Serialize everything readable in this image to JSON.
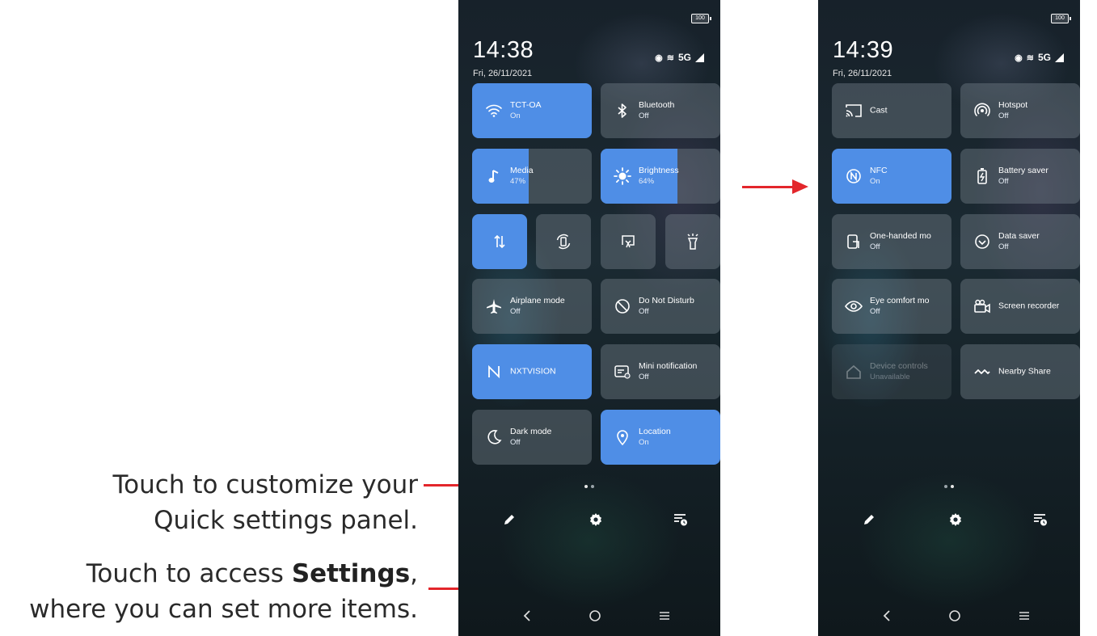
{
  "captions": {
    "customize_line1": "Touch to customize your",
    "customize_line2": "Quick settings panel.",
    "settings_pre": "Touch to access ",
    "settings_bold": "Settings",
    "settings_post": ",",
    "settings_line2": "where you can set more items."
  },
  "phone1": {
    "battery": "100",
    "time": "14:38",
    "date": "Fri, 26/11/2021",
    "network": "5G",
    "tiles": {
      "wifi": {
        "label": "TCT-OA",
        "status": "On"
      },
      "bluetooth": {
        "label": "Bluetooth",
        "status": "Off"
      },
      "media": {
        "label": "Media",
        "status": "47%",
        "level": 0.47
      },
      "brightness": {
        "label": "Brightness",
        "status": "64%",
        "level": 0.64
      },
      "airplane": {
        "label": "Airplane mode",
        "status": "Off"
      },
      "dnd": {
        "label": "Do Not Disturb",
        "status": "Off"
      },
      "nxtvision": {
        "label": "NXTVISION"
      },
      "mini_notification": {
        "label": "Mini notification",
        "status": "Off"
      },
      "dark_mode": {
        "label": "Dark mode",
        "status": "Off"
      },
      "location": {
        "label": "Location",
        "status": "On"
      }
    }
  },
  "phone2": {
    "battery": "100",
    "time": "14:39",
    "date": "Fri, 26/11/2021",
    "network": "5G",
    "tiles": {
      "cast": {
        "label": "Cast"
      },
      "hotspot": {
        "label": "Hotspot",
        "status": "Off"
      },
      "nfc": {
        "label": "NFC",
        "status": "On"
      },
      "battery_saver": {
        "label": "Battery saver",
        "status": "Off"
      },
      "one_handed": {
        "label": "One-handed mo",
        "status": "Off"
      },
      "data_saver": {
        "label": "Data saver",
        "status": "Off"
      },
      "eye_comfort": {
        "label": "Eye comfort mo",
        "status": "Off"
      },
      "screen_recorder": {
        "label": "Screen recorder"
      },
      "device_controls": {
        "label": "Device controls",
        "status": "Unavailable"
      },
      "nearby_share": {
        "label": "Nearby Share"
      }
    }
  },
  "icons": [
    "wifi-icon",
    "bluetooth-icon",
    "music-note-icon",
    "sun-icon",
    "data-arrows-icon",
    "auto-rotate-icon",
    "screenshot-icon",
    "flashlight-icon",
    "airplane-icon",
    "dnd-icon",
    "nxtvision-icon",
    "mini-notification-icon",
    "moon-icon",
    "location-pin-icon",
    "pencil-icon",
    "gear-icon",
    "notification-schedule-icon",
    "back-icon",
    "home-icon",
    "menu-icon",
    "cast-icon",
    "hotspot-icon",
    "nfc-icon",
    "battery-saver-icon",
    "one-handed-icon",
    "data-saver-icon",
    "eye-icon",
    "screen-recorder-icon",
    "home-device-icon",
    "nearby-share-icon"
  ],
  "colors": {
    "active_tile": "#4f8ee6",
    "callout_line": "#e3262b"
  }
}
